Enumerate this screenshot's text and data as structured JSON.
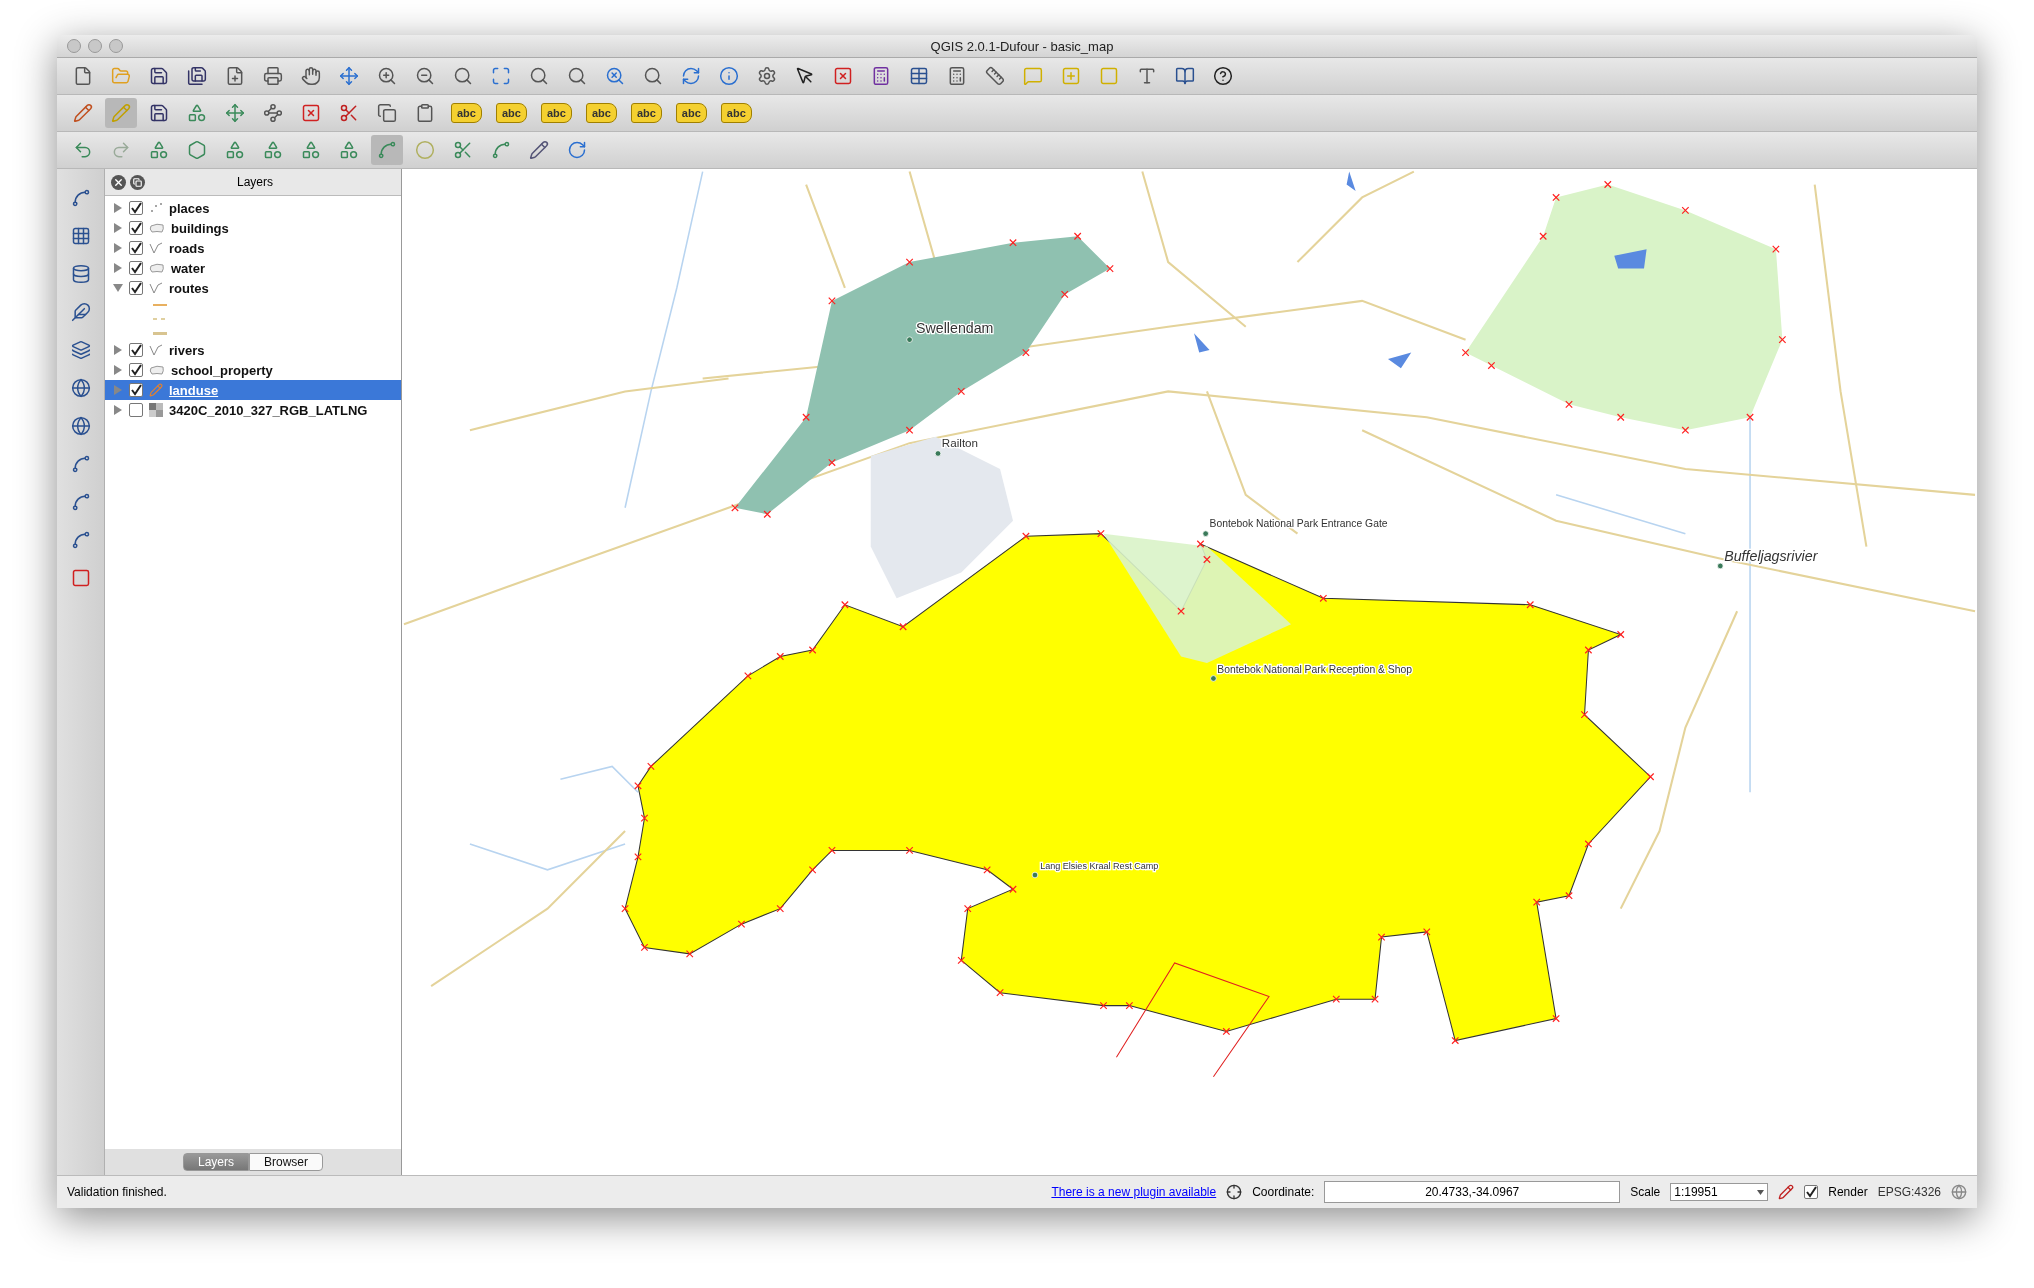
{
  "window": {
    "title": "QGIS 2.0.1-Dufour - basic_map"
  },
  "label_toolbar": {
    "tags": [
      "abc",
      "abc",
      "abc",
      "abc",
      "abc",
      "abc",
      "abc"
    ]
  },
  "layers_panel": {
    "title": "Layers",
    "layers": [
      {
        "name": "places",
        "kind": "point",
        "checked": true,
        "expanded": false,
        "selected": false,
        "editing": false
      },
      {
        "name": "buildings",
        "kind": "polygon",
        "checked": true,
        "expanded": false,
        "selected": false,
        "editing": false
      },
      {
        "name": "roads",
        "kind": "line",
        "checked": true,
        "expanded": false,
        "selected": false,
        "editing": false
      },
      {
        "name": "water",
        "kind": "polygon",
        "checked": true,
        "expanded": false,
        "selected": false,
        "editing": false
      },
      {
        "name": "routes",
        "kind": "line",
        "checked": true,
        "expanded": true,
        "selected": false,
        "editing": false,
        "children": [
          {
            "color": "#e8b060",
            "kind": "solid"
          },
          {
            "color": "#e0d0a0",
            "kind": "dashed"
          },
          {
            "color": "#d8c490",
            "kind": "thick"
          }
        ]
      },
      {
        "name": "rivers",
        "kind": "line",
        "checked": true,
        "expanded": false,
        "selected": false,
        "editing": false
      },
      {
        "name": "school_property",
        "kind": "polygon",
        "checked": true,
        "expanded": false,
        "selected": false,
        "editing": false
      },
      {
        "name": "landuse",
        "kind": "polygon",
        "checked": true,
        "expanded": false,
        "selected": true,
        "editing": true
      },
      {
        "name": "3420C_2010_327_RGB_LATLNG",
        "kind": "raster",
        "checked": false,
        "expanded": false,
        "selected": false,
        "editing": false
      }
    ],
    "tabs": [
      {
        "label": "Layers",
        "selected": true
      },
      {
        "label": "Browser",
        "selected": false
      }
    ]
  },
  "map": {
    "labels": [
      "Swellendam",
      "Railton",
      "Bontebok National Park Entrance Gate",
      "Bontebok National Park Reception & Shop",
      "Lang Elsies Kraal Rest Camp",
      "Buffeljagsrivier"
    ]
  },
  "status_bar": {
    "message": "Validation finished.",
    "plugin_link": "There is a new plugin available",
    "coordinate_label": "Coordinate:",
    "coordinate": "20.4733,-34.0967",
    "scale_label": "Scale",
    "scale": "1:19951",
    "render_checked": true,
    "render_label": "Render",
    "crs": "EPSG:4326"
  }
}
